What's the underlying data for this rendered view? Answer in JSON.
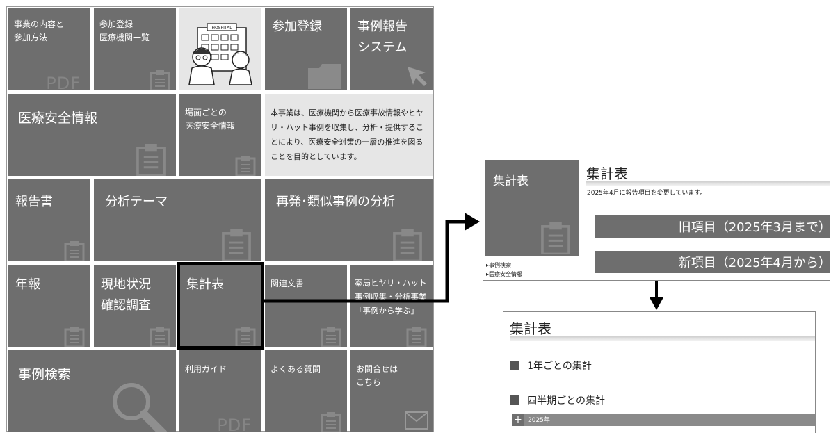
{
  "tiles": {
    "business": "事業の内容と\n参加方法",
    "business_pdf": "PDF",
    "facility_list": "参加登録\n医療機関一覧",
    "hospital_sign": "HOSPITAL",
    "registration": "参加登録",
    "report_system": "事例報告\nシステム",
    "safety_info": "医療安全情報",
    "scene_info": "場面ごとの\n医療安全情報",
    "description": "本事業は、医療機関から医療事故情報やヒヤリ・ハット事例を収集し、分析・提供することにより、医療安全対策の一層の推進を図ることを目的としています。",
    "reports": "報告書",
    "analysis_theme": "分析テーマ",
    "recurrence": "再発･類似事例の分析",
    "annual": "年報",
    "field_survey": "現地状況\n確認調査",
    "statistics": "集計表",
    "related_docs": "関連文書",
    "pharmacy": "薬局ヒヤリ・ハット\n事例収集・分析事業\n「事例から学ぶ」",
    "case_search": "事例検索",
    "user_guide": "利用ガイド",
    "user_guide_pdf": "PDF",
    "faq": "よくある質問",
    "contact": "お問合せは\nこちら"
  },
  "panel1": {
    "side_title": "集計表",
    "side_link1": "事例検索",
    "side_link2": "医療安全情報",
    "title": "集計表",
    "note": "2025年4月に報告項目を変更しています。",
    "old_button": "旧項目（2025年3月まで）",
    "new_button": "新項目（2025年4月から）"
  },
  "panel2": {
    "title": "集計表",
    "item1": "1年ごとの集計",
    "item2": "四半期ごとの集計",
    "expand_symbol": "+",
    "year_row": "2025年"
  },
  "colors": {
    "tile": "#6e6e6e",
    "tile_light": "#e6e6e6",
    "highlight_border": "#000000"
  }
}
